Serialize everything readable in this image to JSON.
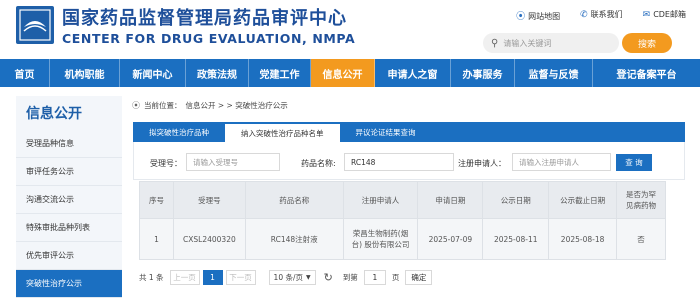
{
  "header": {
    "title_cn": "国家药品监督管理局药品审评中心",
    "title_en": "CENTER FOR DRUG EVALUATION, NMPA",
    "links": [
      {
        "icon": "map-pin-icon",
        "label": "网站地图"
      },
      {
        "icon": "phone-icon",
        "label": "联系我们"
      },
      {
        "icon": "mail-icon",
        "label": "CDE邮箱"
      }
    ],
    "search_placeholder": "请输入关键词",
    "search_button": "搜索"
  },
  "nav": {
    "items": [
      "首页",
      "机构职能",
      "新闻中心",
      "政策法规",
      "党建工作",
      "信息公开",
      "申请人之窗",
      "办事服务",
      "监督与反馈",
      "登记备案平台"
    ],
    "active_index": 5
  },
  "sidebar": {
    "title": "信息公开",
    "items": [
      "受理品种信息",
      "审评任务公示",
      "沟通交流公示",
      "特殊审批品种列表",
      "优先审评公示",
      "突破性治疗公示"
    ],
    "active_index": 5
  },
  "breadcrumb": {
    "prefix": "当前位置：",
    "path": "信息公开 > > 突破性治疗公示"
  },
  "tabs": {
    "items": [
      "拟突破性治疗品种",
      "纳入突破性治疗品种名单",
      "异议论证结果查询"
    ],
    "active_index": 1
  },
  "filters": {
    "accept_no_label": "受理号：",
    "accept_no_placeholder": "请输入受理号",
    "drug_name_label": "药品名称:",
    "drug_name_value": "RC148",
    "applicant_label": "注册申请人：",
    "applicant_placeholder": "请输入注册申请人",
    "query_button": "查 询"
  },
  "table": {
    "headers": [
      "序号",
      "受理号",
      "药品名称",
      "注册申请人",
      "申请日期",
      "公示日期",
      "公示截止日期",
      "是否为罕见病药物"
    ],
    "rows": [
      [
        "1",
        "CXSL2400320",
        "RC148注射液",
        "荣昌生物制药(烟台) 股份有限公司",
        "2025-07-09",
        "2025-08-11",
        "2025-08-18",
        "否"
      ]
    ]
  },
  "pager": {
    "total": "共 1 条",
    "prev": "上一页",
    "current": "1",
    "next": "下一页",
    "page_size": "10 条/页",
    "goto_label": "到第",
    "goto_value": "1",
    "page_unit": "页",
    "confirm": "确定"
  }
}
